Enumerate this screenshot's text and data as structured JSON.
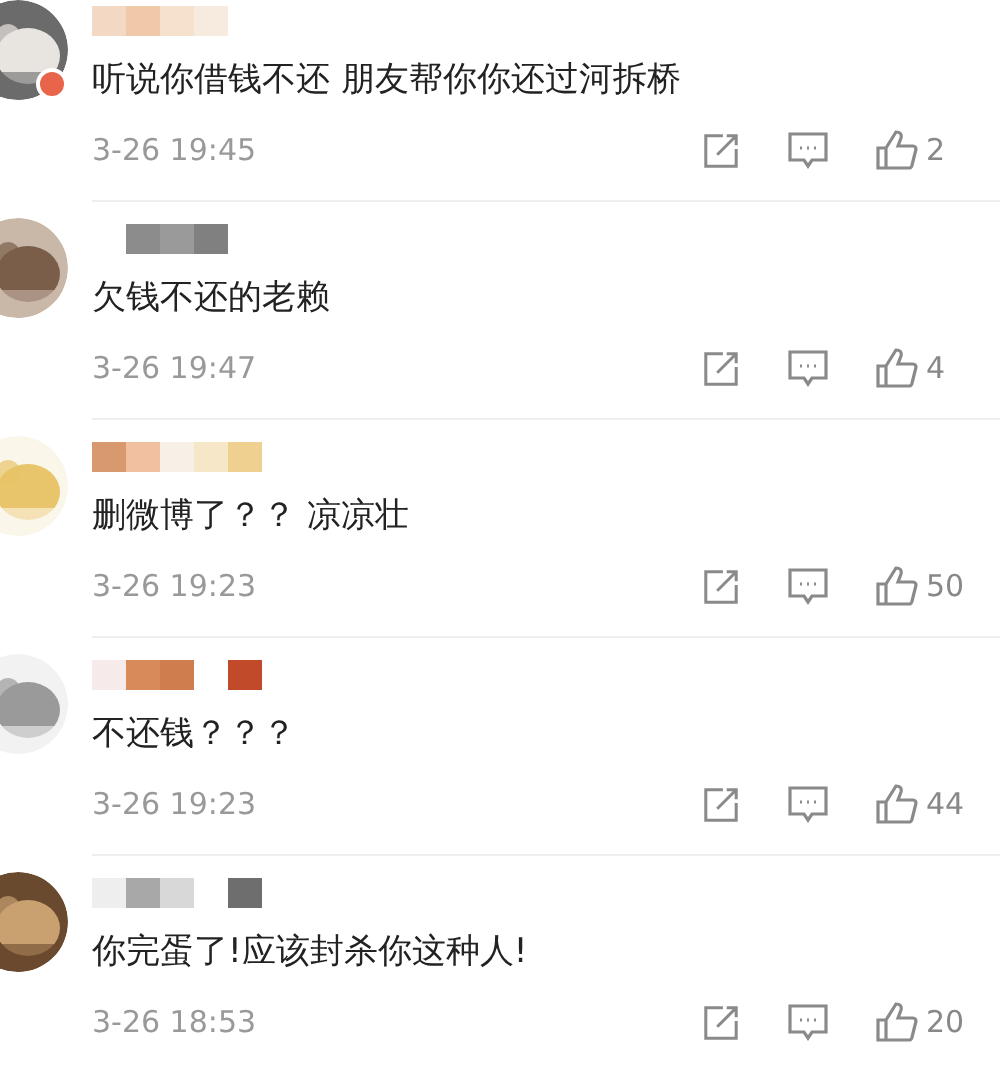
{
  "comments": [
    {
      "text": "听说你借钱不还 朋友帮你你还过河拆桥",
      "time": "3-26 19:45",
      "likes": "2",
      "badge": true
    },
    {
      "text": "欠钱不还的老赖",
      "time": "3-26 19:47",
      "likes": "4",
      "badge": false
    },
    {
      "text": "删微博了？？ 凉凉壮",
      "time": "3-26 19:23",
      "likes": "50",
      "badge": false
    },
    {
      "text": "不还钱？？？",
      "time": "3-26 19:23",
      "likes": "44",
      "badge": false
    },
    {
      "text": "你完蛋了!应该封杀你这种人!",
      "time": "3-26 18:53",
      "likes": "20",
      "badge": false
    }
  ]
}
